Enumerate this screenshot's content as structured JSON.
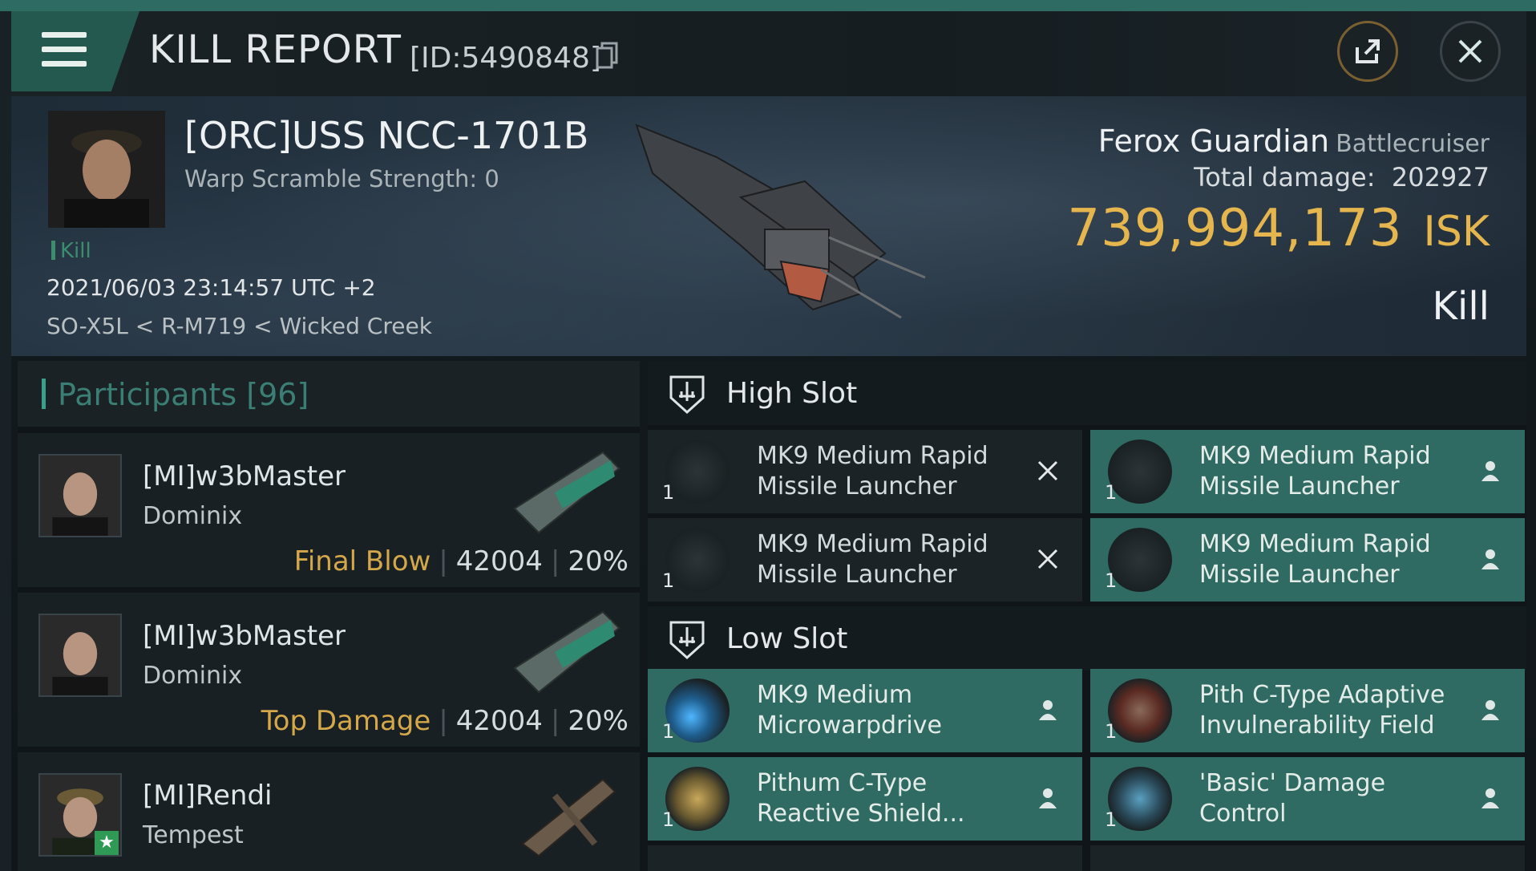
{
  "header": {
    "title": "KILL REPORT",
    "id_label": "[ID:5490848]"
  },
  "victim": {
    "name": "[ORC]USS NCC-1701B",
    "warp_scramble": "Warp Scramble Strength: 0",
    "tag": "Kill",
    "datetime": "2021/06/03 23:14:57 UTC +2",
    "location": "SO-X5L < R-M719 < Wicked Creek",
    "ship_name": "Ferox Guardian",
    "ship_class": "Battlecruiser",
    "total_damage_label": "Total damage:",
    "total_damage": "202927",
    "isk_value": "739,994,173",
    "isk_unit": "ISK",
    "kill_type": "Kill"
  },
  "participants": {
    "label": "Participants [96]",
    "rows": [
      {
        "name": "[MI]w3bMaster",
        "ship": "Dominix",
        "tag": "Final Blow",
        "damage": "42004",
        "percent": "20%"
      },
      {
        "name": "[MI]w3bMaster",
        "ship": "Dominix",
        "tag": "Top Damage",
        "damage": "42004",
        "percent": "20%"
      },
      {
        "name": "[MI]Rendi",
        "ship": "Tempest"
      }
    ]
  },
  "slots": {
    "high": {
      "label": "High Slot",
      "items": [
        {
          "name": "MK9 Medium Rapid Missile Launcher",
          "qty": "1",
          "state": "destroyed"
        },
        {
          "name": "MK9 Medium Rapid Missile Launcher",
          "qty": "1",
          "state": "dropped"
        },
        {
          "name": "MK9 Medium Rapid Missile Launcher",
          "qty": "1",
          "state": "destroyed"
        },
        {
          "name": "MK9 Medium Rapid Missile Launcher",
          "qty": "1",
          "state": "dropped"
        }
      ]
    },
    "low": {
      "label": "Low Slot",
      "items": [
        {
          "name": "MK9 Medium Microwarpdrive",
          "qty": "1",
          "state": "dropped"
        },
        {
          "name": "Pith C-Type Adaptive Invulnerability Field",
          "qty": "1",
          "state": "dropped"
        },
        {
          "name": "Pithum C-Type Reactive Shield...",
          "qty": "1",
          "state": "dropped"
        },
        {
          "name": "'Basic' Damage Control",
          "qty": "1",
          "state": "dropped"
        }
      ]
    }
  },
  "colors": {
    "accent_teal": "#2f6b62",
    "isk_gold": "#e5b54e",
    "tag_gold": "#d4a84a"
  }
}
